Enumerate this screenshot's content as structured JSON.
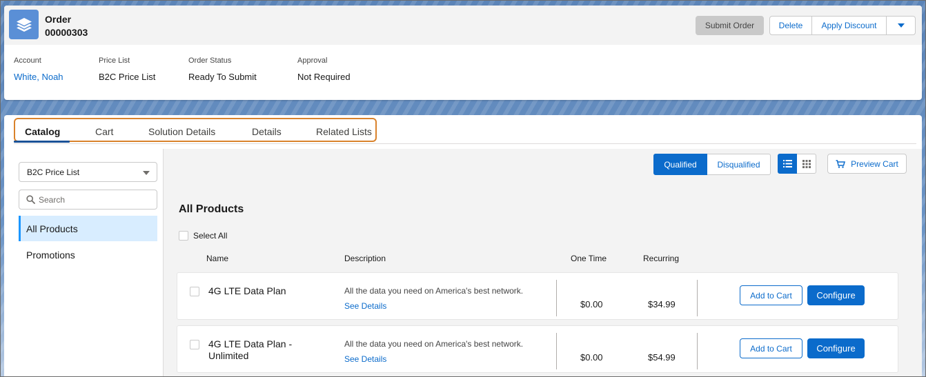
{
  "header": {
    "object_label": "Order",
    "order_number": "00000303",
    "icon": "stacked-layers-icon",
    "actions": {
      "submit": "Submit Order",
      "delete": "Delete",
      "apply_discount": "Apply Discount",
      "more": "chevron-down-icon"
    },
    "fields": [
      {
        "label": "Account",
        "value": "White, Noah",
        "link": true
      },
      {
        "label": "Price List",
        "value": "B2C Price List",
        "link": false
      },
      {
        "label": "Order Status",
        "value": "Ready To Submit",
        "link": false
      },
      {
        "label": "Approval",
        "value": "Not Required",
        "link": false
      }
    ]
  },
  "tabs": [
    {
      "label": "Catalog",
      "active": true
    },
    {
      "label": "Cart",
      "active": false
    },
    {
      "label": "Solution Details",
      "active": false
    },
    {
      "label": "Details",
      "active": false
    },
    {
      "label": "Related Lists",
      "active": false
    }
  ],
  "sidebar": {
    "price_list_selected": "B2C Price List",
    "search_placeholder": "Search",
    "items": [
      {
        "label": "All Products",
        "active": true
      },
      {
        "label": "Promotions",
        "active": false
      }
    ]
  },
  "toolbar": {
    "qualified": "Qualified",
    "disqualified": "Disqualified",
    "list_view_icon": "list-view-icon",
    "grid_view_icon": "grid-view-icon",
    "preview_cart": "Preview Cart",
    "cart_icon": "cart-icon"
  },
  "catalog": {
    "title": "All Products",
    "select_all": "Select All",
    "columns": {
      "name": "Name",
      "description": "Description",
      "one_time": "One Time",
      "recurring": "Recurring"
    },
    "products": [
      {
        "name": "4G LTE Data Plan",
        "description": "All the data you need on America's best network.",
        "details_link": "See Details",
        "one_time": "$0.00",
        "recurring": "$34.99",
        "add_label": "Add to Cart",
        "configure_label": "Configure"
      },
      {
        "name": "4G LTE Data Plan - Unlimited",
        "description": "All the data you need on America's best network.",
        "details_link": "See Details",
        "one_time": "$0.00",
        "recurring": "$54.99",
        "add_label": "Add to Cart",
        "configure_label": "Configure"
      }
    ]
  },
  "colors": {
    "brand_blue": "#0b6bcb",
    "highlight_orange": "#d9822b",
    "icon_blue": "#5a8fd6"
  }
}
